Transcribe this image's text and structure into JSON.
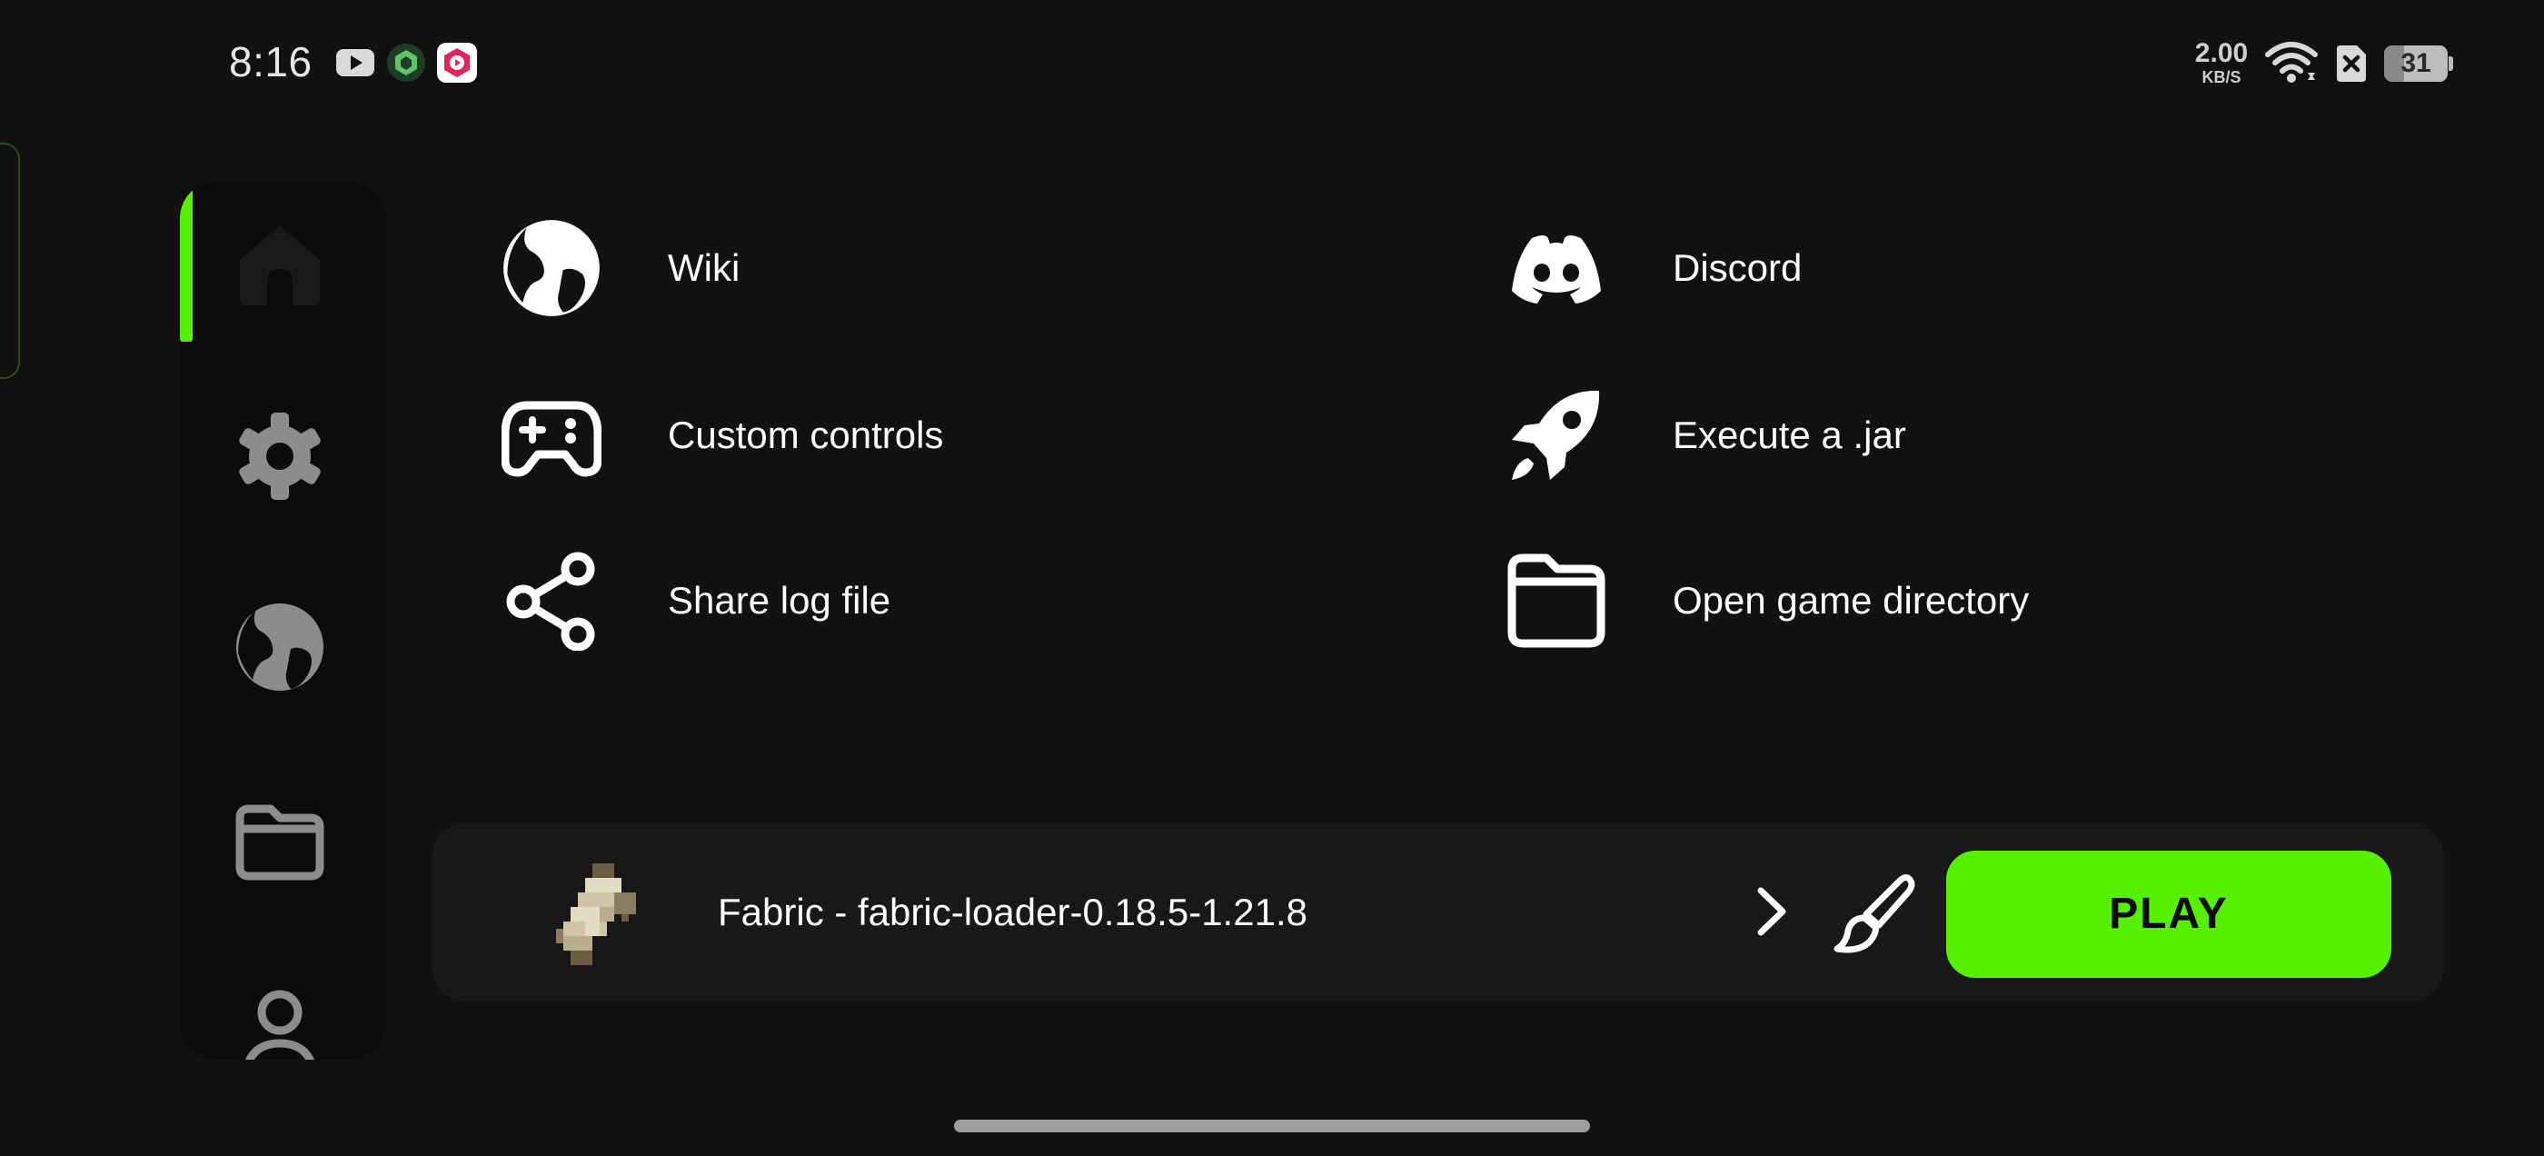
{
  "status_bar": {
    "time": "8:16",
    "notification_icons": [
      "youtube-icon",
      "green-hex-app-icon",
      "red-play-app-icon"
    ],
    "network_speed_value": "2.00",
    "network_speed_unit": "KB/S",
    "battery_level": "31"
  },
  "sidebar": {
    "active_item": "home",
    "items": [
      {
        "id": "home",
        "icon": "home-icon"
      },
      {
        "id": "settings",
        "icon": "gear-icon"
      },
      {
        "id": "web",
        "icon": "globe-icon"
      },
      {
        "id": "files",
        "icon": "folder-icon"
      },
      {
        "id": "account",
        "icon": "person-icon"
      }
    ]
  },
  "actions": {
    "wiki": {
      "label": "Wiki",
      "icon": "globe-icon"
    },
    "discord": {
      "label": "Discord",
      "icon": "discord-icon"
    },
    "custom_controls": {
      "label": "Custom controls",
      "icon": "gamepad-icon"
    },
    "execute_jar": {
      "label": "Execute a .jar",
      "icon": "rocket-icon"
    },
    "share_log": {
      "label": "Share log file",
      "icon": "share-icon"
    },
    "open_directory": {
      "label": "Open game directory",
      "icon": "folder-icon"
    }
  },
  "launcher_bar": {
    "profile_name": "Fabric - fabric-loader-0.18.5-1.21.8",
    "profile_icon": "fabric-scroll-icon",
    "play_label": "PLAY"
  },
  "colors": {
    "background": "#111111",
    "accent": "#56f000",
    "sidebar_bg": "#0c0c0c",
    "bar_bg": "#181818",
    "inactive_icon": "#8c8c8c"
  }
}
